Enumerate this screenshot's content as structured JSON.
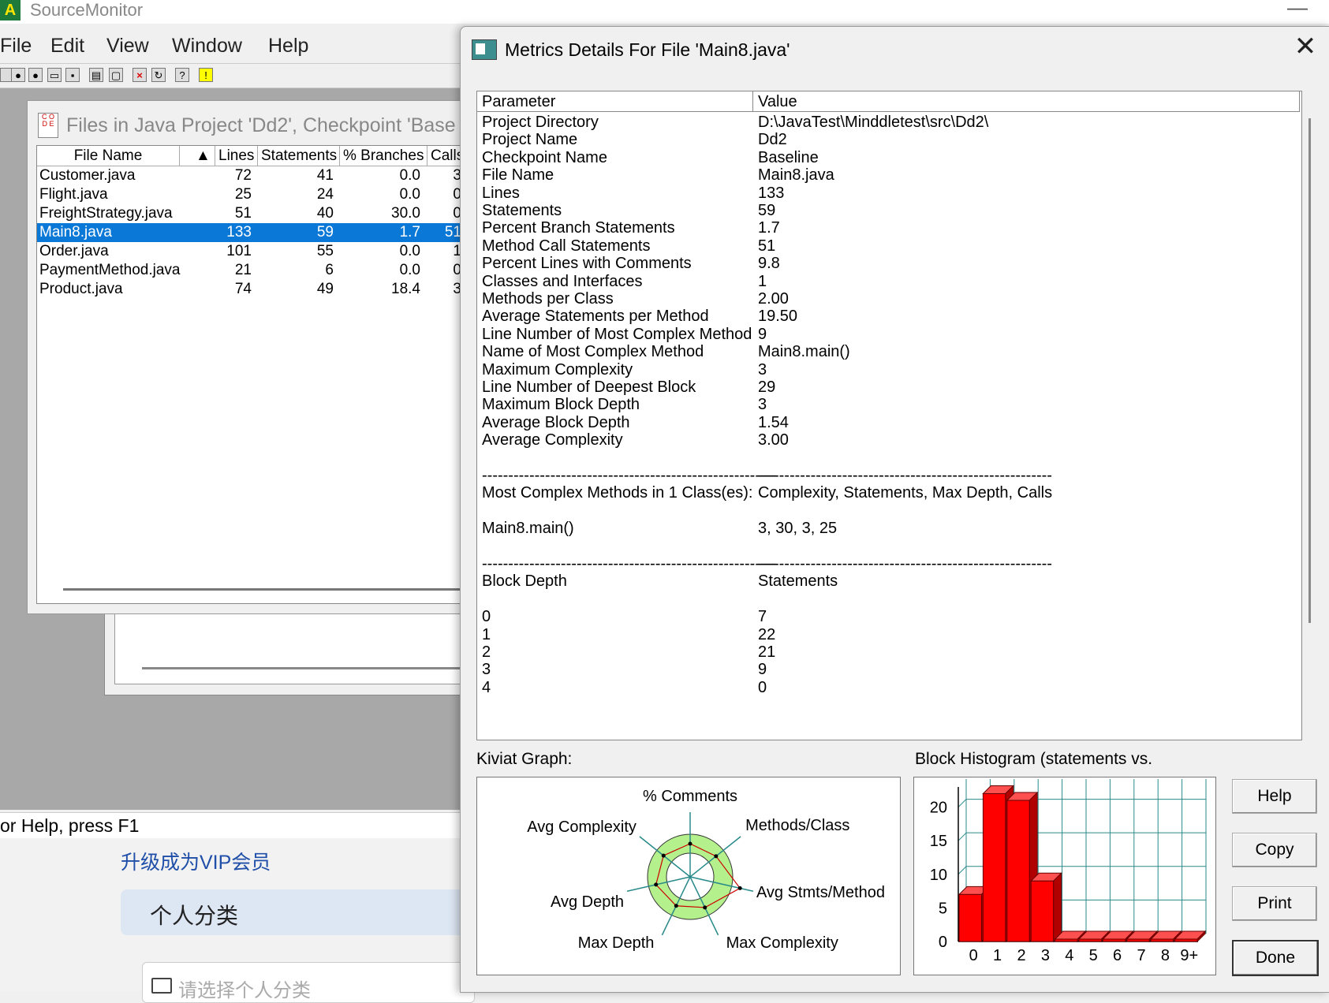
{
  "app": {
    "title": "SourceMonitor",
    "logo_letter": "A",
    "minimize_glyph": "—"
  },
  "menubar": {
    "items": [
      "File",
      "Edit",
      "View",
      "Window",
      "Help"
    ]
  },
  "toolbar": {
    "icons": [
      "new-file-icon",
      "open-project-icon",
      "checkpoint-icon",
      "open-folder-icon",
      "save-icon",
      "print-icon",
      "print-preview-icon",
      "delete-icon",
      "refresh-icon",
      "context-help-icon",
      "tip-icon"
    ]
  },
  "files_window": {
    "title": "Files in Java Project 'Dd2', Checkpoint 'Base",
    "icon_text": "C O D E",
    "columns": [
      "File Name",
      "Lines",
      "Statements",
      "% Branches",
      "Calls"
    ],
    "sort_indicator": "▲",
    "rows": [
      {
        "file": "Customer.java",
        "lines": "72",
        "statements": "41",
        "branches": "0.0",
        "calls": "3"
      },
      {
        "file": "Flight.java",
        "lines": "25",
        "statements": "24",
        "branches": "0.0",
        "calls": "0"
      },
      {
        "file": "FreightStrategy.java",
        "lines": "51",
        "statements": "40",
        "branches": "30.0",
        "calls": "0"
      },
      {
        "file": "Main8.java",
        "lines": "133",
        "statements": "59",
        "branches": "1.7",
        "calls": "51"
      },
      {
        "file": "Order.java",
        "lines": "101",
        "statements": "55",
        "branches": "0.0",
        "calls": "1"
      },
      {
        "file": "PaymentMethod.java",
        "lines": "21",
        "statements": "6",
        "branches": "0.0",
        "calls": "0"
      },
      {
        "file": "Product.java",
        "lines": "74",
        "statements": "49",
        "branches": "18.4",
        "calls": "3"
      }
    ],
    "selected_index": 3
  },
  "status": {
    "text": "or Help, press F1"
  },
  "background_page": {
    "vip_link": "升级成为VIP会员",
    "category_label": "个人分类",
    "category_placeholder": "请选择个人分类"
  },
  "dialog": {
    "title": "Metrics Details For File 'Main8.java'",
    "close_glyph": "✕",
    "columns": [
      "Parameter",
      "Value"
    ],
    "rows": [
      [
        "Project Directory",
        "D:\\JavaTest\\Minddletest\\src\\Dd2\\"
      ],
      [
        "Project Name",
        "Dd2"
      ],
      [
        "Checkpoint Name",
        "Baseline"
      ],
      [
        "File Name",
        "Main8.java"
      ],
      [
        "Lines",
        "133"
      ],
      [
        "Statements",
        "59"
      ],
      [
        "Percent Branch Statements",
        "1.7"
      ],
      [
        "Method Call Statements",
        "51"
      ],
      [
        "Percent Lines with Comments",
        "9.8"
      ],
      [
        "Classes and Interfaces",
        "1"
      ],
      [
        "Methods per Class",
        "2.00"
      ],
      [
        "Average Statements per Method",
        "19.50"
      ],
      [
        "Line Number of Most Complex Method",
        "9"
      ],
      [
        "Name of Most Complex Method",
        "Main8.main()"
      ],
      [
        "Maximum Complexity",
        "3"
      ],
      [
        "Line Number of Deepest Block",
        "29"
      ],
      [
        "Maximum Block Depth",
        "3"
      ],
      [
        "Average Block Depth",
        "1.54"
      ],
      [
        "Average Complexity",
        "3.00"
      ],
      [
        "",
        ""
      ],
      [
        "--------------------------------------------------------",
        "--------------------------------------------------------"
      ],
      [
        "Most Complex Methods in 1 Class(es):",
        "Complexity, Statements, Max Depth, Calls"
      ],
      [
        "",
        ""
      ],
      [
        "Main8.main()",
        "3, 30, 3, 25"
      ],
      [
        "",
        ""
      ],
      [
        "--------------------------------------------------------",
        "--------------------------------------------------------"
      ],
      [
        "Block Depth",
        "Statements"
      ],
      [
        "",
        ""
      ],
      [
        "0",
        "7"
      ],
      [
        "1",
        "22"
      ],
      [
        "2",
        "21"
      ],
      [
        "3",
        "9"
      ],
      [
        "4",
        "0"
      ]
    ],
    "kiviat_label": "Kiviat Graph:",
    "histogram_label": "Block Histogram (statements vs.",
    "buttons": {
      "help": "Help",
      "copy": "Copy",
      "print": "Print",
      "done": "Done"
    }
  },
  "kiviat": {
    "axes": [
      "% Comments",
      "Methods/Class",
      "Avg Stmts/Method",
      "Max Complexity",
      "Max Depth",
      "Avg Depth",
      "Avg Complexity"
    ],
    "values": [
      0.5,
      0.5,
      1.45,
      0.55,
      0.45,
      0.6,
      0.55
    ],
    "ring_color": "#b4f08c",
    "plot_color": "#cc0000"
  },
  "chart_data": {
    "type": "bar",
    "categories": [
      "0",
      "1",
      "2",
      "3",
      "4",
      "5",
      "6",
      "7",
      "8",
      "9+"
    ],
    "values": [
      7,
      22,
      21,
      9,
      0,
      0,
      0,
      0,
      0,
      0
    ],
    "ylim": [
      0,
      23
    ],
    "y_ticks": [
      "0",
      "5",
      "10",
      "15",
      "20"
    ],
    "grid": true,
    "bar_color": "#ff0000",
    "grid_color": "#2a8a8a"
  }
}
